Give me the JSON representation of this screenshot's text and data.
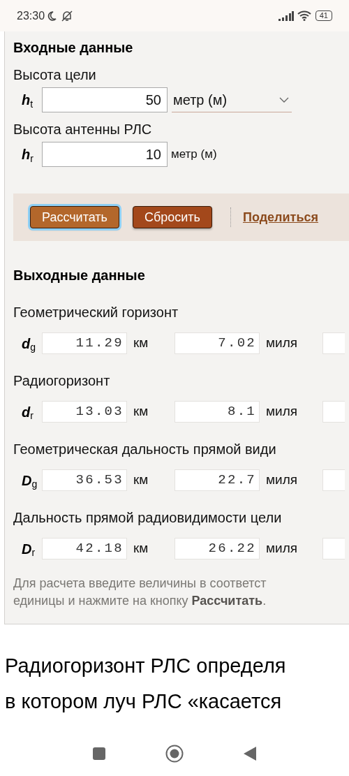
{
  "status_bar": {
    "time": "23:30",
    "battery": "41"
  },
  "input_section": {
    "title": "Входные данные",
    "fields": [
      {
        "label": "Высота цели",
        "symbol": {
          "letter": "h",
          "sub": "t"
        },
        "value": "50",
        "unit": "метр (м)",
        "kind": "select"
      },
      {
        "label": "Высота антенны РЛС",
        "symbol": {
          "letter": "h",
          "sub": "r"
        },
        "value": "10",
        "unit": "метр (м)",
        "kind": "text"
      }
    ]
  },
  "actions": {
    "buttons": [
      {
        "label": "Рассчитать",
        "kind": "primary",
        "focused": true
      },
      {
        "label": "Сбросить",
        "kind": "secondary",
        "focused": false
      }
    ],
    "share_link": "Поделиться"
  },
  "output_section": {
    "title": "Выходные данные",
    "results": [
      {
        "label": "Геометрический горизонт",
        "symbol": {
          "letter": "d",
          "sub": "g"
        },
        "values": [
          {
            "value": "11.29",
            "unit": "км"
          },
          {
            "value": "7.02",
            "unit": "миля"
          }
        ]
      },
      {
        "label": "Радиогоризонт",
        "symbol": {
          "letter": "d",
          "sub": "r"
        },
        "values": [
          {
            "value": "13.03",
            "unit": "км"
          },
          {
            "value": "8.1",
            "unit": "миля"
          }
        ]
      },
      {
        "label": "Геометрическая дальность прямой види",
        "symbol": {
          "letter": "D",
          "sub": "g"
        },
        "values": [
          {
            "value": "36.53",
            "unit": "км"
          },
          {
            "value": "22.7",
            "unit": "миля"
          }
        ]
      },
      {
        "label": "Дальность прямой радиовидимости цели",
        "symbol": {
          "letter": "D",
          "sub": "r"
        },
        "values": [
          {
            "value": "42.18",
            "unit": "км"
          },
          {
            "value": "26.22",
            "unit": "миля"
          }
        ]
      }
    ]
  },
  "note": [
    "Для расчета введите величины в соответст",
    "единицы и нажмите на кнопку **Рассчитать**."
  ],
  "article": [
    "Радиогоризонт РЛС определя",
    "в котором луч РЛС «касается"
  ]
}
